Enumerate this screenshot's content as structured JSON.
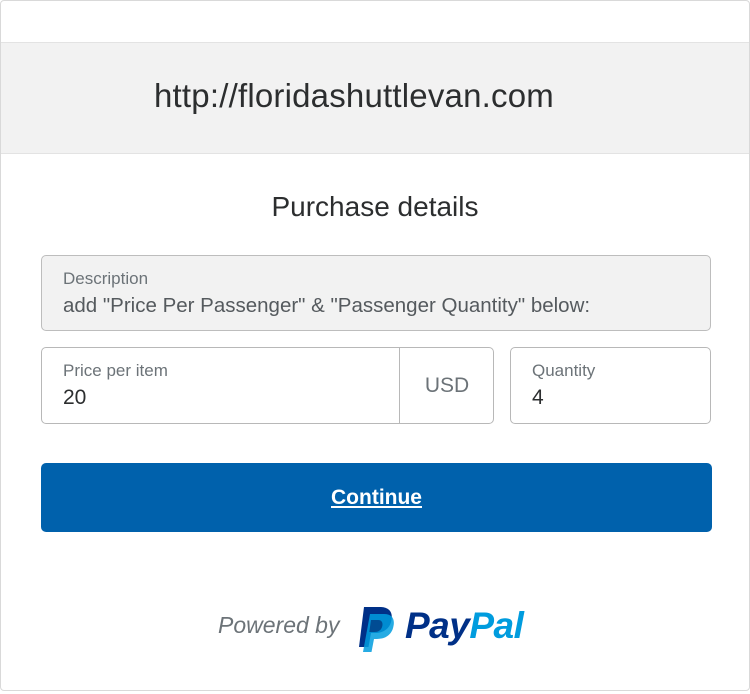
{
  "header": {
    "site_url": "http://floridashuttlevan.com"
  },
  "main": {
    "title": "Purchase details",
    "description": {
      "label": "Description",
      "value": "add \"Price Per Passenger\" & \"Passenger Quantity\" below:"
    },
    "price": {
      "label": "Price per item",
      "value": "20",
      "currency": "USD"
    },
    "quantity": {
      "label": "Quantity",
      "value": "4"
    },
    "continue_label": "Continue"
  },
  "footer": {
    "powered_by": "Powered by",
    "brand_part1": "Pay",
    "brand_part2": "Pal",
    "logo_icon": "paypal-p-icon"
  },
  "colors": {
    "button": "#0061ac",
    "paypal_dark": "#003087",
    "paypal_light": "#009cde",
    "header_bg": "#f2f2f2"
  }
}
